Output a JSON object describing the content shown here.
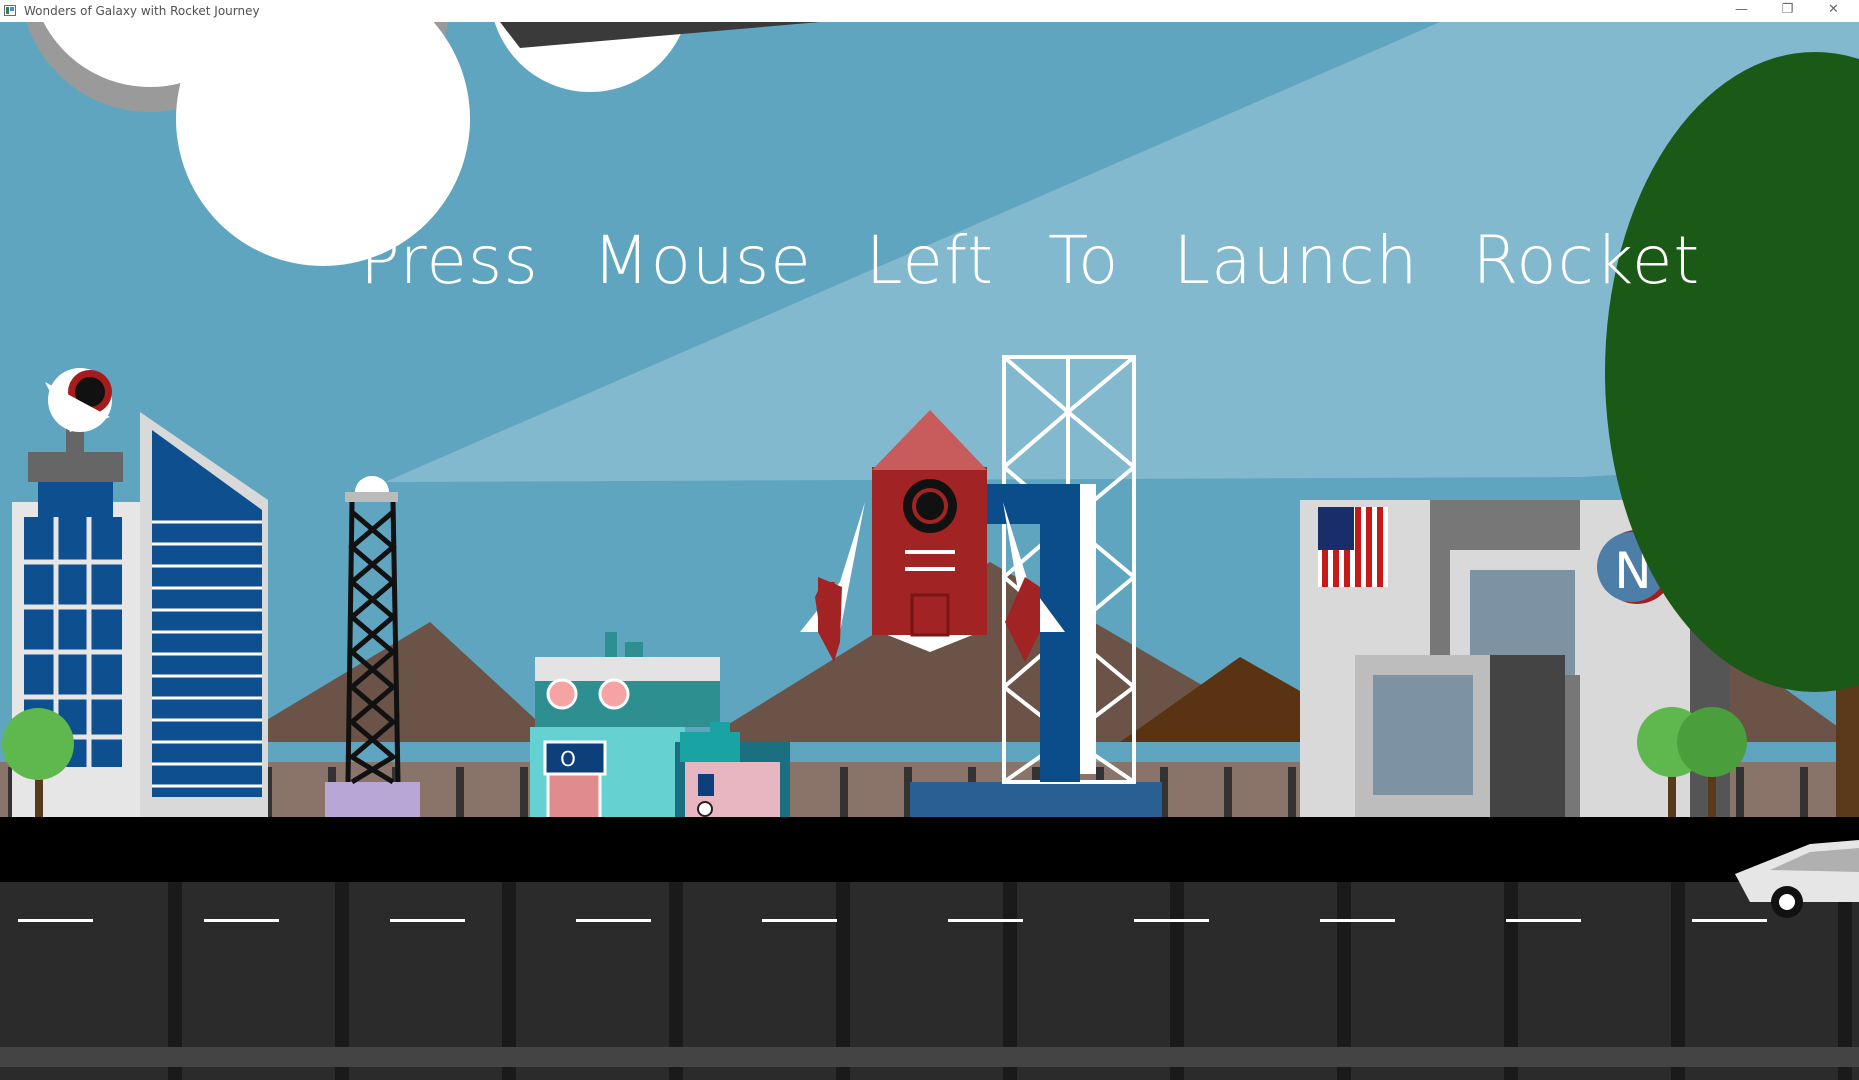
{
  "window": {
    "title": "Wonders of Galaxy with Rocket Journey",
    "controls": {
      "minimize_icon": "minimize-icon",
      "maximize_icon": "restore-icon",
      "close_icon": "close-icon",
      "minimize": "—",
      "maximize": "❐",
      "close": "✕"
    }
  },
  "scene": {
    "prompt": "Press Mouse Left To Launch Rocket",
    "store_sign": "O",
    "badge_letter": "N"
  },
  "colors": {
    "sky": "#5fa5bf",
    "road": "#2b2b2b",
    "asphalt_edge": "#000000",
    "mountain": "#6b5348",
    "rocket_red": "#a12323",
    "tower_blue": "#0b4d8a",
    "tree_green": "#1b5a16"
  }
}
